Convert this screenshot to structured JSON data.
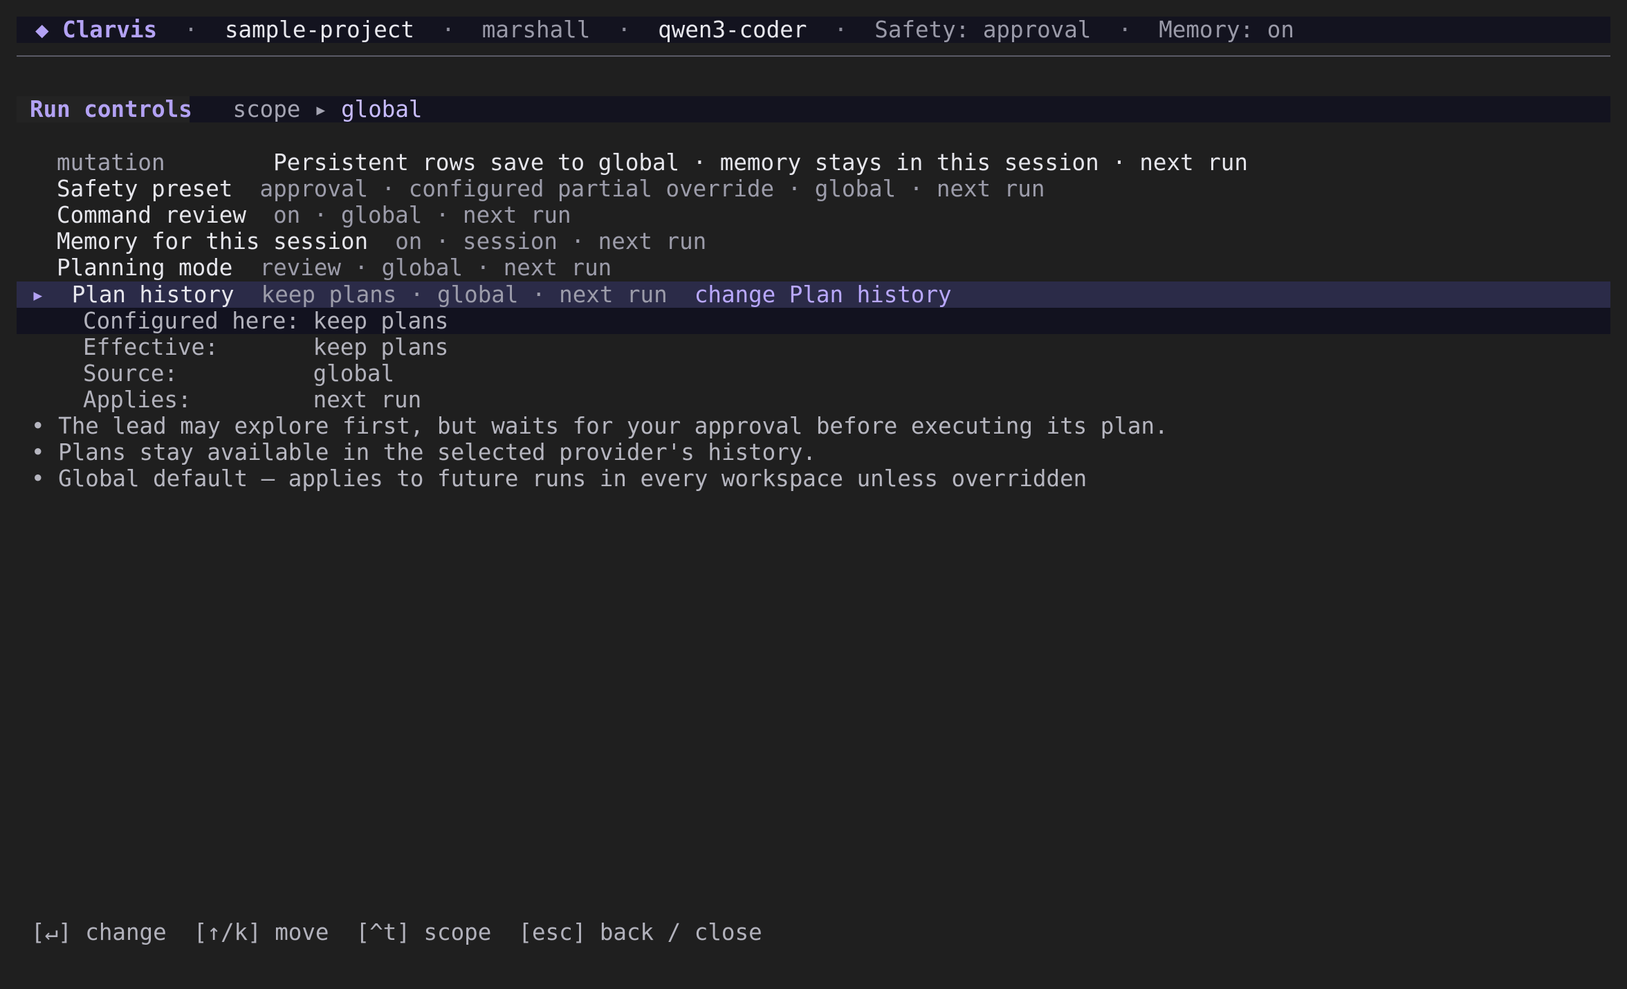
{
  "header": {
    "logo_icon": "diamond-icon",
    "logo_glyph": "◆",
    "app_name": "Clarvis",
    "separator": "·",
    "project": "sample-project",
    "user": "marshall",
    "model": "qwen3-coder",
    "safety": "Safety: approval",
    "memory": "Memory: on"
  },
  "section": {
    "title": "Run controls",
    "scope_label": "scope",
    "scope_arrow": "▸",
    "scope_value": "global"
  },
  "mutation": {
    "label": "mutation",
    "text": "Persistent rows save to global · memory stays in this session · next run"
  },
  "settings": [
    {
      "label": "Safety preset",
      "value": "approval · configured partial override · global · next run"
    },
    {
      "label": "Command review",
      "value": "on · global · next run"
    },
    {
      "label": "Memory for this session",
      "value": "on · session · next run"
    },
    {
      "label": "Planning mode",
      "value": "review · global · next run"
    }
  ],
  "selected": {
    "caret": "▸",
    "label": "Plan history",
    "value": "keep plans · global · next run",
    "action": "change Plan history"
  },
  "details": [
    {
      "label": "Configured here:",
      "value": "keep plans"
    },
    {
      "label": "Effective:",
      "value": "keep plans"
    },
    {
      "label": "Source:",
      "value": "global"
    },
    {
      "label": "Applies:",
      "value": "next run"
    }
  ],
  "notes": [
    "• The lead may explore first, but waits for your approval before executing its plan.",
    "• Plans stay available in the selected provider's history.",
    "• Global default — applies to future runs in every workspace unless overridden"
  ],
  "footer": {
    "change": "[↵] change",
    "move": "[↑/k] move",
    "scope": "[^t] scope",
    "back": "[esc] back / close"
  },
  "colors": {
    "background": "#1f1f1f",
    "header_bar": "#13131f",
    "accent": "#b3a2f4",
    "selection": "#2b2b48"
  }
}
